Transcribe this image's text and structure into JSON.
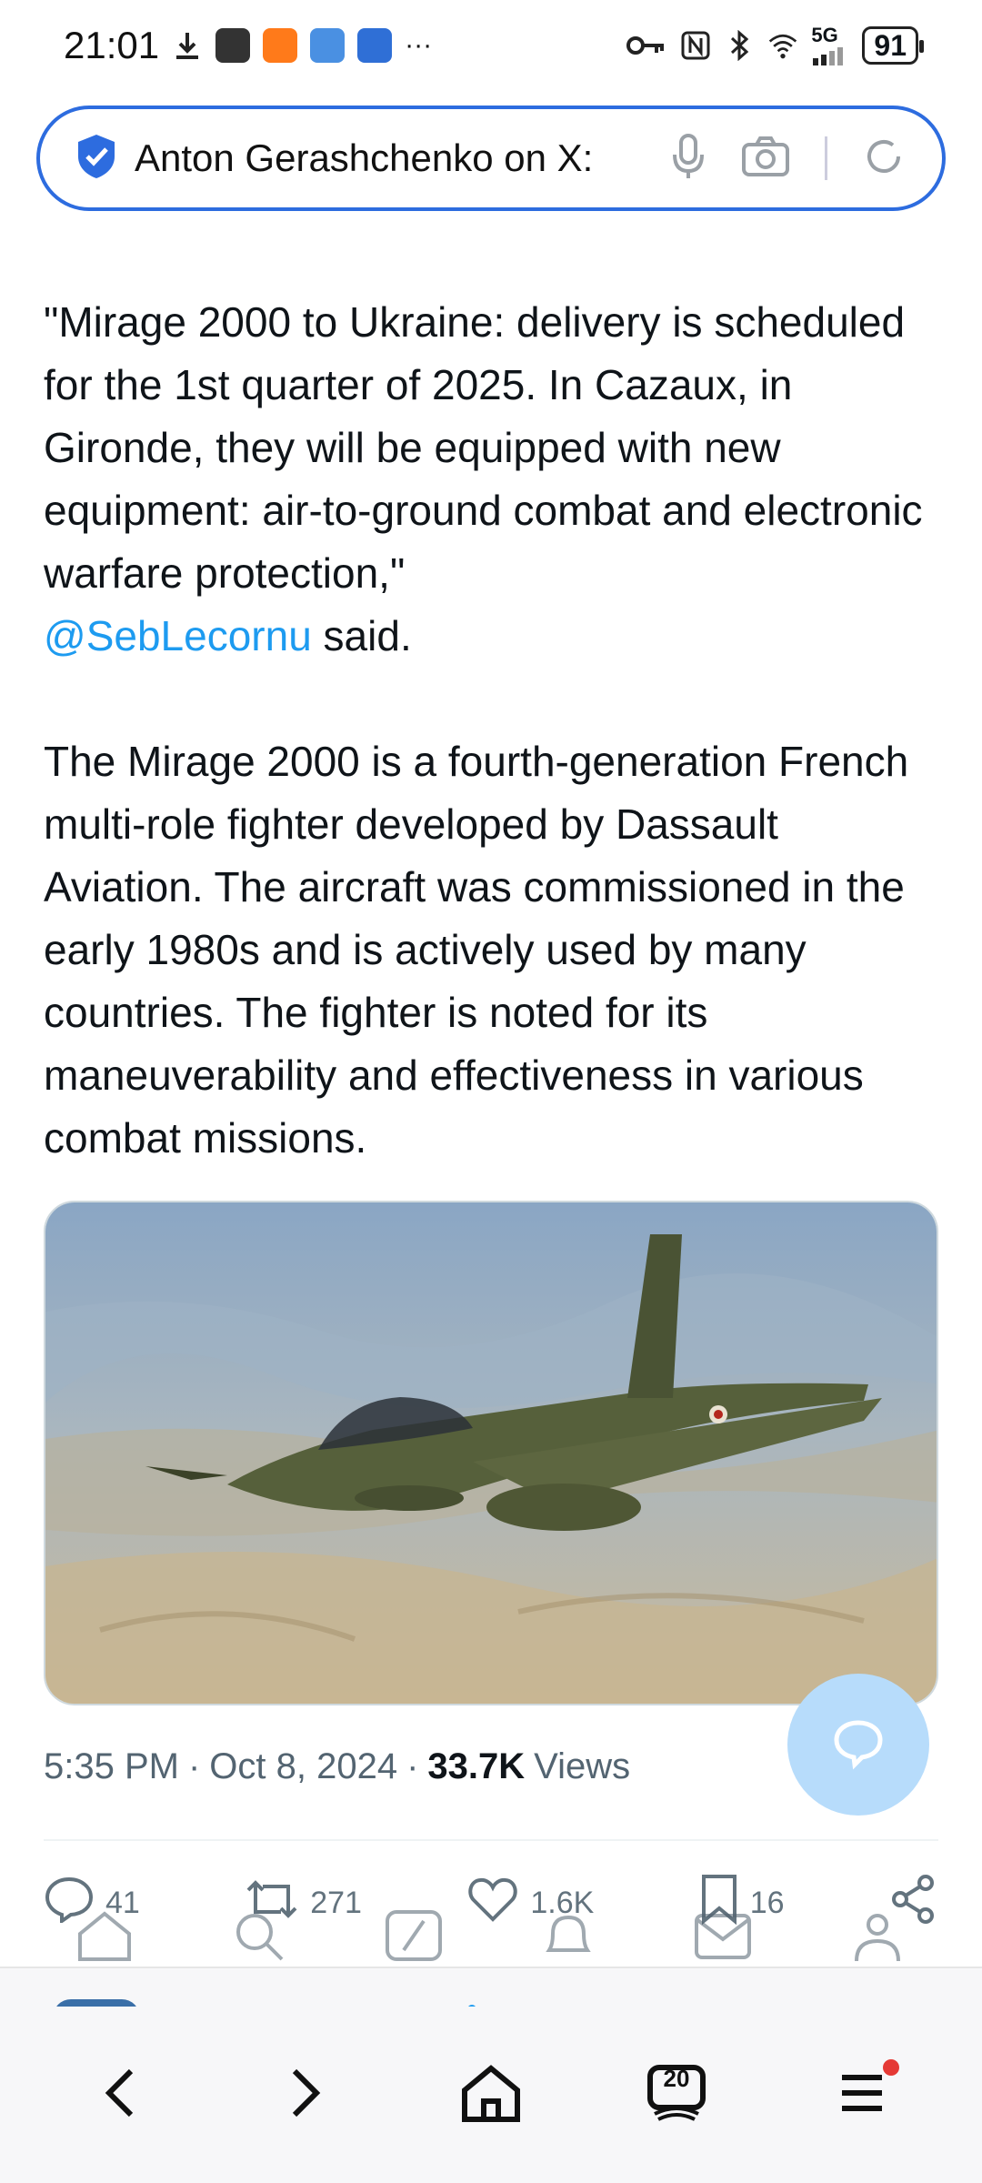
{
  "status_bar": {
    "time": "21:01",
    "more": "···",
    "network": "5G",
    "battery": "91"
  },
  "address_bar": {
    "title": "Anton Gerashchenko on X:"
  },
  "tweet": {
    "quote": "\"Mirage 2000 to Ukraine: delivery is scheduled for the 1st quarter of 2025. In Cazaux, in Gironde, they will be equipped with new equipment: air-to-ground combat and electronic warfare protection,\"",
    "mention": "@SebLecornu",
    "said": " said.",
    "body": "The Mirage 2000 is a fourth-generation French multi-role fighter developed by Dassault Aviation. The aircraft was commissioned in the early 1980s and is actively used by many countries. The fighter is noted for its maneuverability and effectiveness in various combat missions.",
    "time": "5:35 PM",
    "date": "Oct 8, 2024",
    "sep": "·",
    "views_count": "33.7K",
    "views_label": "Views"
  },
  "actions": {
    "replies": "41",
    "reposts": "271",
    "likes": "1.6K",
    "bookmarks": "16"
  },
  "browser_nav": {
    "tab_count": "20"
  },
  "colors": {
    "accent": "#1d9bf0",
    "address_border": "#2d6cdf",
    "fab": "#b7dcfb"
  },
  "icons": [
    "download-icon",
    "mail-icon",
    "play-icon",
    "weather-icon",
    "shield-app-icon",
    "key-icon",
    "nfc-icon",
    "bluetooth-icon",
    "wifi-icon",
    "signal-icon",
    "verified-shield-icon",
    "mic-icon",
    "camera-icon",
    "refresh-icon",
    "reply-icon",
    "repost-icon",
    "like-icon",
    "bookmark-icon",
    "share-icon",
    "compose-icon",
    "back-icon",
    "forward-icon",
    "home-icon",
    "tabs-icon",
    "menu-icon"
  ]
}
